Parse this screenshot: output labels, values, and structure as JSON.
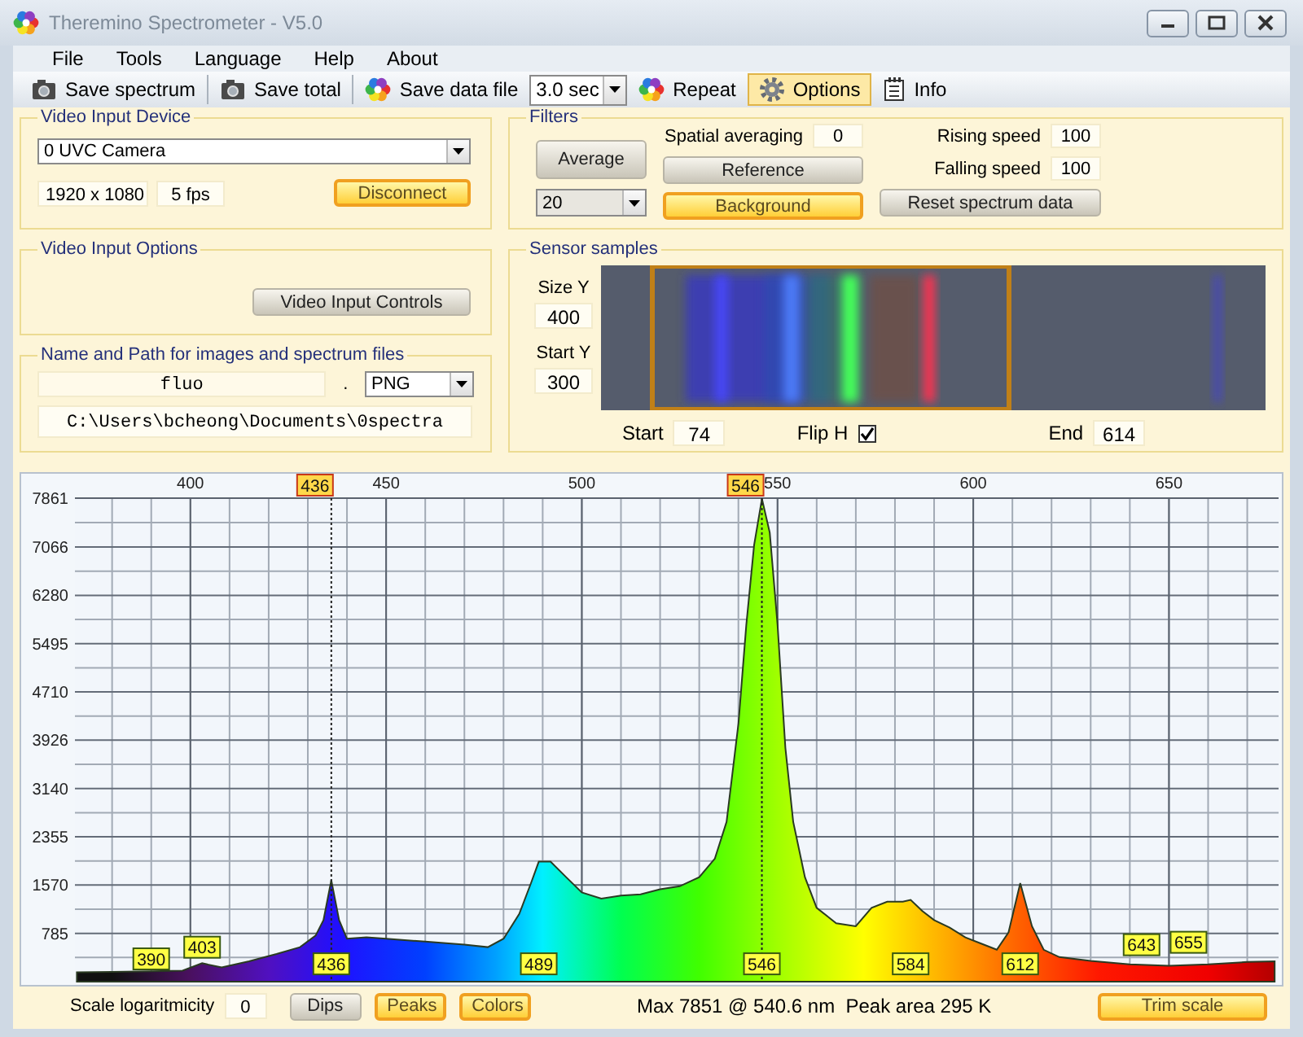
{
  "window": {
    "title": "Theremino Spectrometer - V5.0"
  },
  "menu": [
    "File",
    "Tools",
    "Language",
    "Help",
    "About"
  ],
  "toolbar": [
    {
      "kind": "button",
      "label": "Save spectrum"
    },
    {
      "kind": "button",
      "label": "Save total"
    },
    {
      "kind": "button",
      "label": "Save data file"
    },
    {
      "kind": "combo",
      "value": "3.0 sec"
    },
    {
      "kind": "button",
      "label": "Repeat"
    },
    {
      "kind": "toggle",
      "label": "Options",
      "selected": true
    },
    {
      "kind": "button",
      "label": "Info"
    }
  ],
  "video_input_device": {
    "title": "Video Input Device",
    "device": "0 UVC Camera",
    "resolution": "1920 x 1080",
    "frame_rate": "5 fps",
    "disconnect": {
      "label": "Disconnect",
      "on": true
    }
  },
  "video_input_options": {
    "title": "Video Input Options",
    "controls": {
      "label": "Video Input Controls",
      "on": false
    }
  },
  "file_names": {
    "title": "Name and Path for images and spectrum files",
    "name": "fluo",
    "separator": ".",
    "format": "PNG",
    "path": "C:\\Users\\bcheong\\Documents\\0spectra"
  },
  "filters": {
    "title": "Filters",
    "average": {
      "label": "Average",
      "on": false
    },
    "average_count": "20",
    "spatial_averaging": {
      "label": "Spatial averaging",
      "value": "0"
    },
    "reference": {
      "label": "Reference",
      "on": false
    },
    "background": {
      "label": "Background",
      "on": true
    },
    "rising_speed": {
      "label": "Rising speed",
      "value": "100"
    },
    "falling_speed": {
      "label": "Falling speed",
      "value": "100"
    },
    "reset": {
      "label": "Reset spectrum data",
      "on": false
    }
  },
  "sensor_samples": {
    "title": "Sensor samples",
    "size_y": {
      "label": "Size Y",
      "value": "400"
    },
    "start_y": {
      "label": "Start Y",
      "value": "300"
    },
    "start": {
      "label": "Start",
      "value": "74"
    },
    "flip_h": {
      "label": "Flip H",
      "checked": true
    },
    "end": {
      "label": "End",
      "value": "614"
    }
  },
  "spectrum": {
    "chart_data": {
      "type": "area",
      "x": [
        371,
        380,
        390,
        398,
        403,
        408,
        415,
        422,
        428,
        432,
        434,
        436,
        438,
        440,
        445,
        450,
        460,
        470,
        476,
        480,
        484,
        487,
        489,
        492,
        496,
        500,
        505,
        510,
        515,
        520,
        525,
        530,
        534,
        537,
        540,
        542,
        544,
        546,
        548,
        550,
        552,
        554,
        557,
        560,
        565,
        570,
        574,
        578,
        582,
        584,
        587,
        590,
        594,
        598,
        602,
        606,
        609,
        612,
        615,
        618,
        622,
        630,
        640,
        650,
        660,
        670,
        677
      ],
      "series": [
        {
          "color": "#2a3a22",
          "values": [
            150,
            160,
            170,
            180,
            300,
            230,
            330,
            450,
            560,
            750,
            1000,
            1650,
            1000,
            700,
            720,
            700,
            650,
            600,
            560,
            700,
            1100,
            1600,
            1950,
            1950,
            1700,
            1450,
            1350,
            1400,
            1420,
            1500,
            1550,
            1700,
            2000,
            2600,
            4200,
            5800,
            7100,
            7850,
            7300,
            5800,
            3800,
            2600,
            1700,
            1200,
            950,
            900,
            1200,
            1300,
            1300,
            1330,
            1150,
            1000,
            880,
            720,
            620,
            520,
            800,
            1600,
            900,
            520,
            400,
            340,
            280,
            260,
            280,
            320,
            330
          ]
        }
      ],
      "xlim": [
        370.5,
        678
      ],
      "ylim": [
        0,
        7861
      ],
      "xticks": [
        400,
        450,
        500,
        550,
        600,
        650
      ],
      "grid": true,
      "yticks": [
        785,
        1570,
        2355,
        3140,
        3926,
        4710,
        5495,
        6280,
        7066,
        7861
      ],
      "ref_lines": [
        {
          "axis": "x",
          "value": 436,
          "label": "436"
        },
        {
          "axis": "x",
          "value": 546,
          "label": "546"
        }
      ],
      "annotations": [
        {
          "x": 390,
          "y": 370,
          "text": "390"
        },
        {
          "x": 403,
          "y": 560,
          "text": "403"
        },
        {
          "x": 436,
          "y": 290,
          "text": "436"
        },
        {
          "x": 489,
          "y": 290,
          "text": "489"
        },
        {
          "x": 546,
          "y": 290,
          "text": "546"
        },
        {
          "x": 584,
          "y": 290,
          "text": "584"
        },
        {
          "x": 612,
          "y": 290,
          "text": "612"
        },
        {
          "x": 643,
          "y": 600,
          "text": "643"
        },
        {
          "x": 655,
          "y": 640,
          "text": "655"
        }
      ]
    }
  },
  "bottom_bar": {
    "scale_logaritmicity": {
      "label": "Scale logaritmicity",
      "value": "0"
    },
    "buttons": [
      {
        "label": "Dips",
        "on": false
      },
      {
        "label": "Peaks",
        "on": true
      },
      {
        "label": "Colors",
        "on": true
      }
    ],
    "status": "Max 7851 @ 540.6 nm  Peak area 295 K",
    "trim_scale": {
      "label": "Trim scale",
      "on": true
    }
  }
}
